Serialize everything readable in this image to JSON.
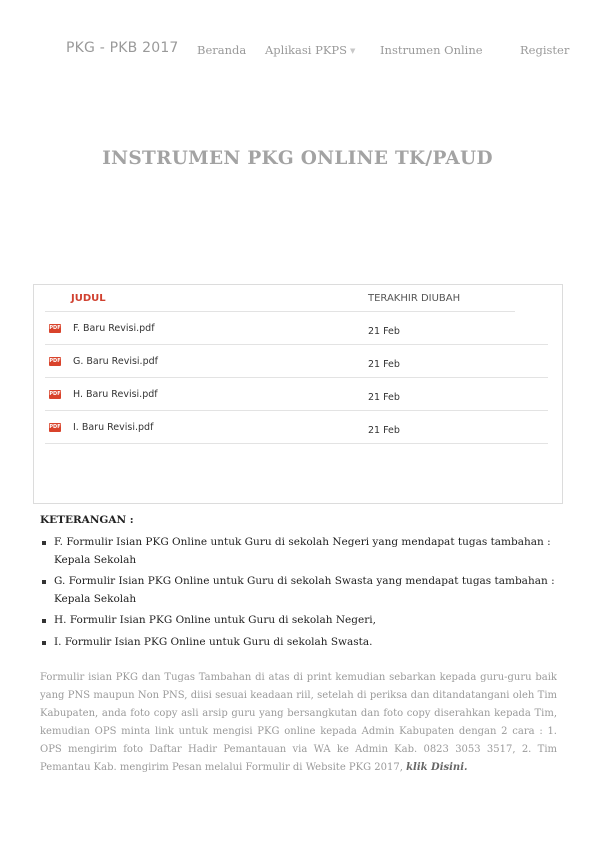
{
  "nav": {
    "brand": "PKG - PKB 2017",
    "items": [
      {
        "label": "Beranda"
      },
      {
        "label": "Aplikasi PKPS"
      },
      {
        "label": "Instrumen Online"
      },
      {
        "label": "Register"
      }
    ]
  },
  "page_title": "INSTRUMEN PKG ONLINE TK/PAUD",
  "files": {
    "columns": {
      "title": "JUDUL",
      "modified": "TERAKHIR DIUBAH"
    },
    "icon_label": "PDF",
    "rows": [
      {
        "name": "F. Baru Revisi.pdf",
        "date": "21 Feb"
      },
      {
        "name": "G. Baru Revisi.pdf",
        "date": "21 Feb"
      },
      {
        "name": "H. Baru Revisi.pdf",
        "date": "21 Feb"
      },
      {
        "name": "I. Baru Revisi.pdf",
        "date": "21 Feb"
      }
    ]
  },
  "keterangan": {
    "title": "KETERANGAN :",
    "items": [
      "F. Formulir Isian PKG Online untuk Guru di sekolah Negeri yang mendapat tugas tambahan : Kepala Sekolah",
      "G. Formulir Isian PKG Online untuk Guru di sekolah Swasta yang mendapat tugas tambahan : Kepala Sekolah",
      "H. Formulir Isian PKG Online untuk Guru di sekolah Negeri,",
      "I. Formulir Isian PKG Online untuk Guru di sekolah Swasta."
    ]
  },
  "description": {
    "text": "Formulir isian PKG dan Tugas Tambahan di atas di print kemudian sebarkan kepada guru-guru baik yang PNS maupun Non PNS, diisi sesuai keadaan riil, setelah di periksa dan ditandatangani oleh Tim Kabupaten, anda foto copy asli arsip guru yang bersangkutan dan foto copy diserahkan kepada Tim, kemudian OPS minta link untuk mengisi PKG online kepada Admin Kabupaten dengan 2 cara : 1. OPS mengirim foto Daftar Hadir Pemantauan via WA ke Admin Kab. 0823 3053 3517, 2. Tim Pemantau Kab. mengirim Pesan melalui Formulir  di Website PKG 2017, ",
    "link": "klik Disini."
  }
}
